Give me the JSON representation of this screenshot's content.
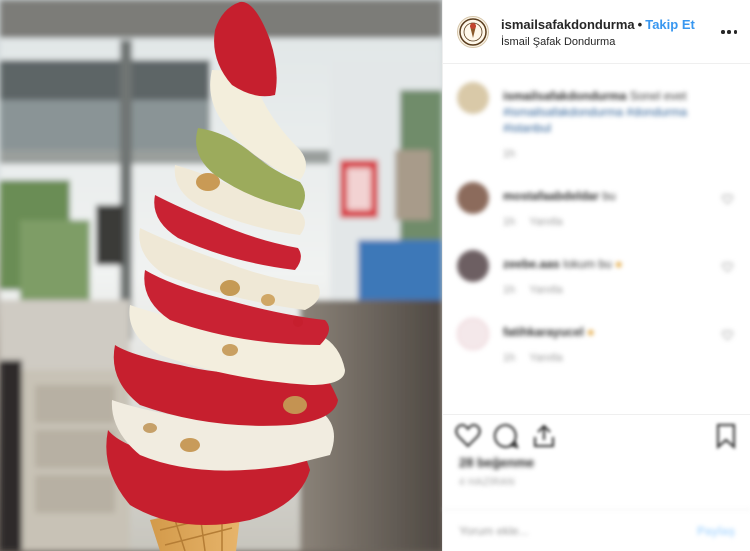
{
  "post_header": {
    "username": "ismailsafakdondurma",
    "separator": "•",
    "follow_label": "Takip Et",
    "subtitle": "İsmail Şafak Dondurma",
    "more_icon": "more-options-icon"
  },
  "comments_section": {
    "caption": {
      "username": "ismailsafakdondurma",
      "text": "Sonel evet",
      "hashtags": "#ismailsafakdondurma #dondurma #istanbul",
      "time": "1h"
    },
    "comments": [
      {
        "username": "mostafaabdeldar",
        "text": "bu",
        "time": "1h",
        "reply_label": "Yanıtla"
      },
      {
        "username": "zeebe.aas",
        "text": "lokum bu",
        "time": "1h",
        "reply_label": "Yanıtla"
      },
      {
        "username": "fatihkarayucel",
        "text": "",
        "time": "1h",
        "reply_label": "Yanıtla"
      }
    ]
  },
  "footer": {
    "icons": [
      "heart-icon",
      "comment-icon",
      "share-icon",
      "bookmark-icon"
    ],
    "likes": "28 beğenme",
    "date": "4 HAZİRAN",
    "comment_placeholder": "Yorum ekle...",
    "post_label": "Paylaş"
  },
  "colors": {
    "accent_link": "#3897f0",
    "text_primary": "#262626",
    "text_muted": "#9a9a9a",
    "divider": "#efefef",
    "sorbet_red": "#c8202f"
  }
}
